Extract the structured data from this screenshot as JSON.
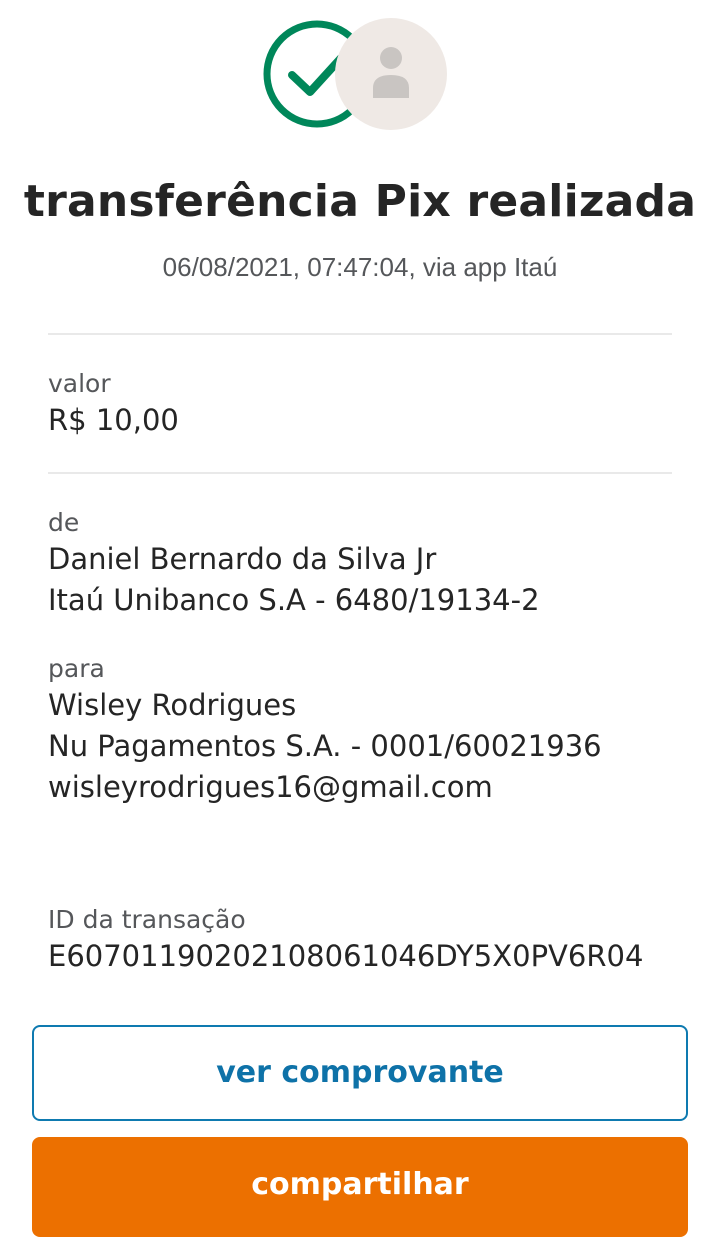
{
  "status": {
    "icon": "check-circle-icon",
    "avatar_icon": "person-icon",
    "title": "transferência Pix realizada",
    "datetime": "06/08/2021,  07:47:04, via app Itaú"
  },
  "amount": {
    "label": "valor",
    "value": "R$ 10,00"
  },
  "from": {
    "label": "de",
    "name": "Daniel Bernardo da Silva Jr",
    "bank": "Itaú Unibanco S.A - 6480/19134-2"
  },
  "to": {
    "label": "para",
    "name": "Wisley Rodrigues",
    "bank": "Nu Pagamentos S.A. - 0001/60021936",
    "key": "wisleyrodrigues16@gmail.com"
  },
  "transaction": {
    "label": "ID da transação",
    "id": "E60701190202108061046DY5X0PV6R04"
  },
  "actions": {
    "receipt_label": "ver comprovante",
    "share_label": "compartilhar"
  },
  "colors": {
    "success": "#00875a",
    "link": "#0e72a8",
    "primary": "#ec7000"
  }
}
